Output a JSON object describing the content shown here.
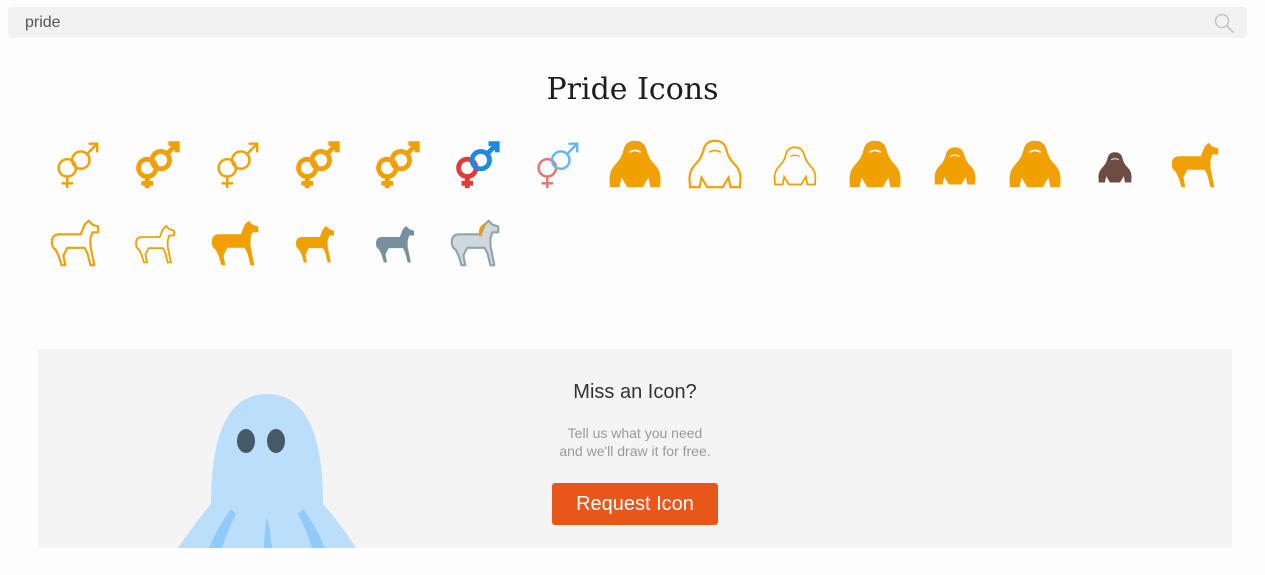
{
  "search": {
    "value": "pride",
    "placeholder": ""
  },
  "page_title": "Pride Icons",
  "icons": [
    {
      "name": "genderqueer-icon",
      "kind": "gender",
      "color": "#f0a000",
      "style": "outline"
    },
    {
      "name": "genderqueer-bold-icon",
      "kind": "gender",
      "color": "#f0a000",
      "style": "bold"
    },
    {
      "name": "genderqueer-thin-icon",
      "kind": "gender",
      "color": "#f0a000",
      "style": "outline"
    },
    {
      "name": "genderqueer-medium-icon",
      "kind": "gender",
      "color": "#f0a000",
      "style": "bold"
    },
    {
      "name": "genderqueer-small-icon",
      "kind": "gender",
      "color": "#f0a000",
      "style": "bold"
    },
    {
      "name": "genderqueer-color-icon",
      "kind": "gender",
      "color": "#e53935",
      "color2": "#1e88e5",
      "style": "bold"
    },
    {
      "name": "genderqueer-color-outline-icon",
      "kind": "gender",
      "color": "#e57373",
      "color2": "#64b5f6",
      "style": "outline"
    },
    {
      "name": "gorilla-icon",
      "kind": "gorilla",
      "color": "#f0a000",
      "style": "fill"
    },
    {
      "name": "gorilla-outline-icon",
      "kind": "gorilla",
      "color": "#f0a000",
      "style": "outline"
    },
    {
      "name": "gorilla-small-outline-icon",
      "kind": "gorilla",
      "color": "#f0a000",
      "style": "outline-small"
    },
    {
      "name": "gorilla-fill-icon",
      "kind": "gorilla",
      "color": "#f0a000",
      "style": "fill"
    },
    {
      "name": "gorilla-walking-icon",
      "kind": "gorilla",
      "color": "#f0a000",
      "style": "fill-small"
    },
    {
      "name": "gorilla-fill-alt-icon",
      "kind": "gorilla",
      "color": "#f0a000",
      "style": "fill"
    },
    {
      "name": "gorilla-color-icon",
      "kind": "gorilla",
      "color": "#6d4c41",
      "style": "fill-tiny"
    },
    {
      "name": "horse-icon",
      "kind": "horse",
      "color": "#f0a000",
      "style": "fill"
    },
    {
      "name": "horse-outline-icon",
      "kind": "horse",
      "color": "#f0a000",
      "style": "outline"
    },
    {
      "name": "horse-thin-outline-icon",
      "kind": "horse",
      "color": "#f0a000",
      "style": "outline-small"
    },
    {
      "name": "horse-fill-icon",
      "kind": "horse",
      "color": "#f0a000",
      "style": "fill"
    },
    {
      "name": "horse-fill-alt-icon",
      "kind": "horse",
      "color": "#f0a000",
      "style": "fill-small"
    },
    {
      "name": "horse-grey-icon",
      "kind": "horse",
      "color": "#78909c",
      "style": "fill-small"
    },
    {
      "name": "unicorn-icon",
      "kind": "horse",
      "color": "#cfd8dc",
      "color2": "#f0a000",
      "style": "outline-fill"
    }
  ],
  "banner": {
    "title": "Miss an Icon?",
    "desc_line1": "Tell us what you need",
    "desc_line2": "and we'll draw it for free.",
    "button_label": "Request Icon"
  },
  "colors": {
    "accent": "#e8561a",
    "icon": "#f0a000",
    "ghost": "#bbdefb"
  }
}
